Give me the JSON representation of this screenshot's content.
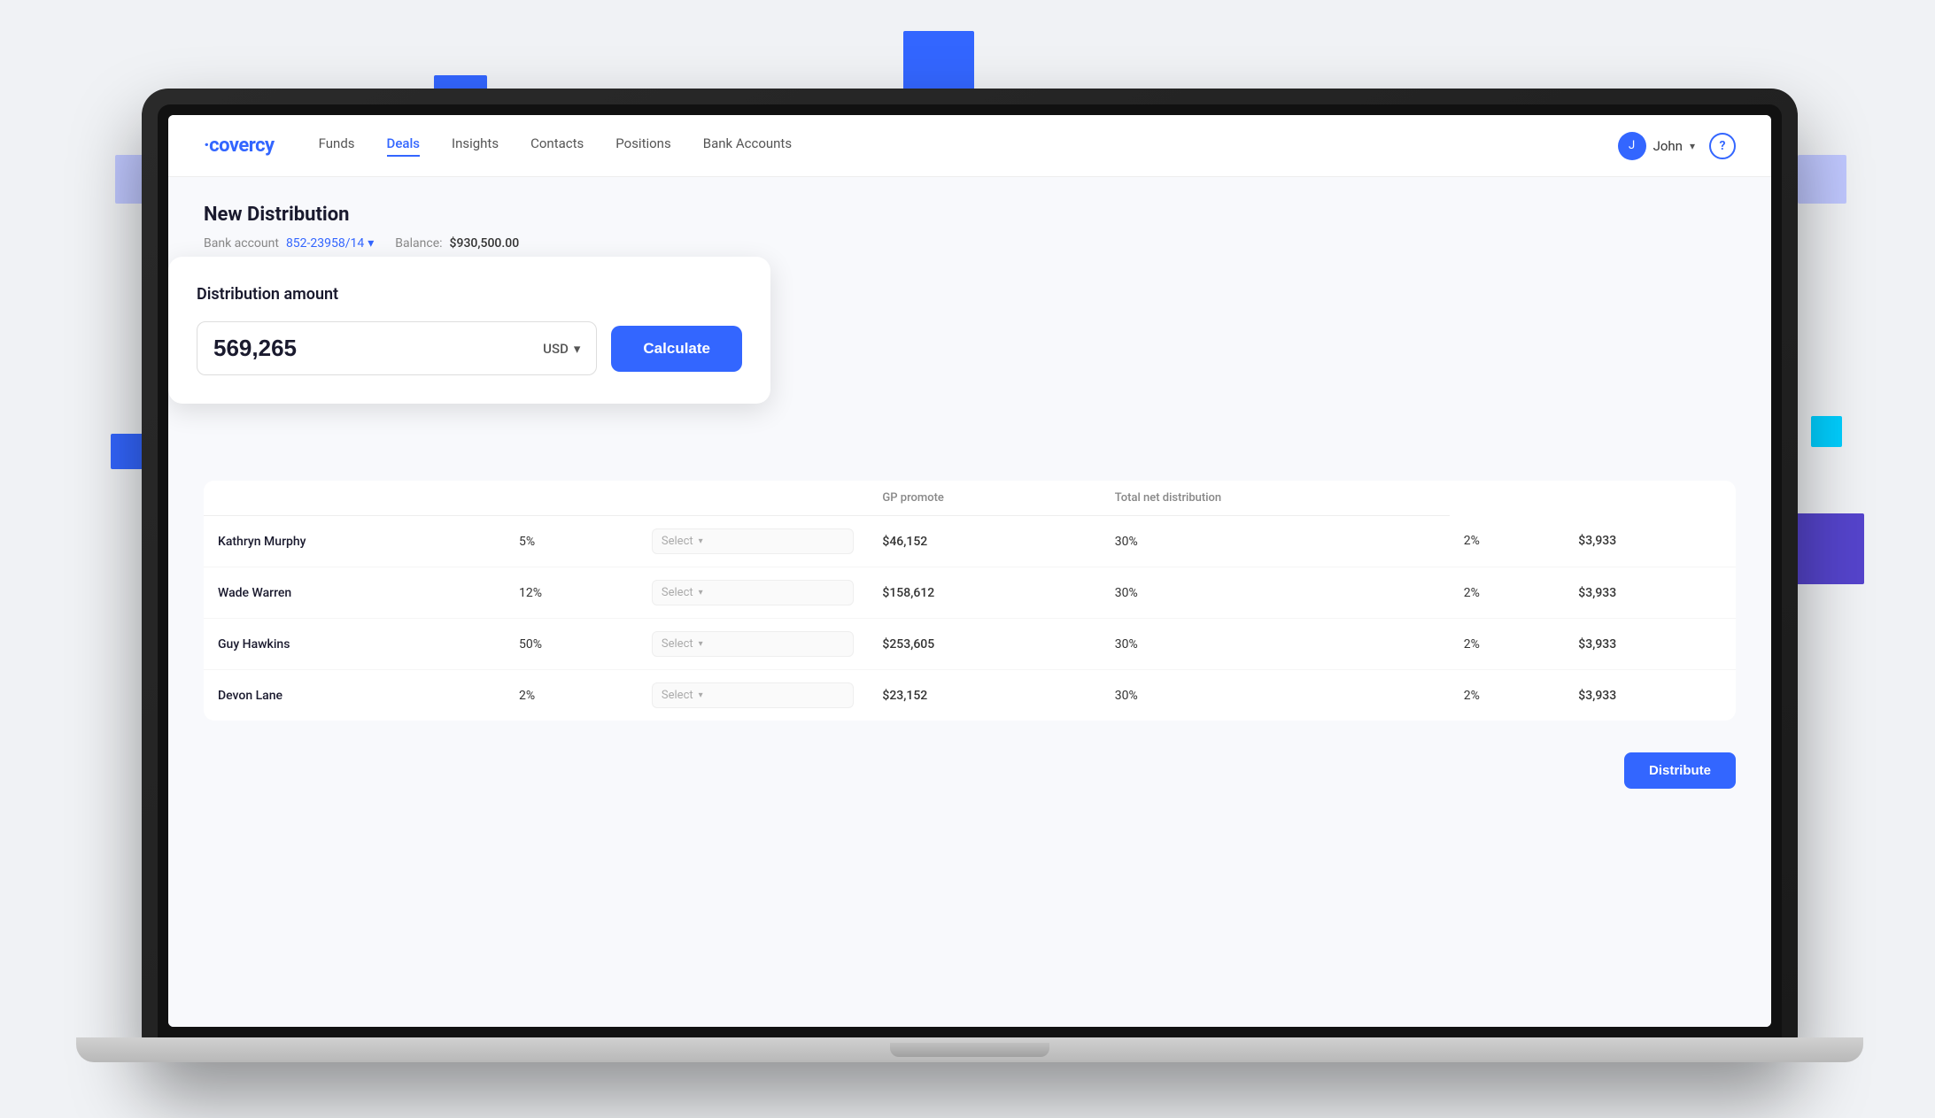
{
  "decorative": {
    "squares": []
  },
  "navbar": {
    "logo": "covercy",
    "links": [
      {
        "label": "Funds",
        "id": "funds",
        "active": false
      },
      {
        "label": "Deals",
        "id": "deals",
        "active": true
      },
      {
        "label": "Insights",
        "id": "insights",
        "active": false
      },
      {
        "label": "Contacts",
        "id": "contacts",
        "active": false
      },
      {
        "label": "Positions",
        "id": "positions",
        "active": false
      },
      {
        "label": "Bank Accounts",
        "id": "bank-accounts",
        "active": false
      }
    ],
    "user": {
      "name": "John",
      "avatar_initials": "J",
      "chevron": "▾"
    },
    "help": "?"
  },
  "page": {
    "title": "New Distribution",
    "bank_account_label": "Bank account",
    "bank_account_value": "852-23958/14",
    "balance_label": "Balance:",
    "balance_value": "$930,500.00"
  },
  "distribution_card": {
    "title": "Distribution amount",
    "amount": "569,265",
    "currency": "USD",
    "currency_chevron": "▾",
    "calculate_label": "Calculate"
  },
  "table": {
    "columns": [
      "",
      "",
      "",
      "GP promote",
      "Total net distribution"
    ],
    "rows": [
      {
        "name": "Kathryn Murphy",
        "percent": "5%",
        "select_placeholder": "Select",
        "amount": "$46,152",
        "hurdle": "30%",
        "gp_promote": "2%",
        "net_distribution": "$3,933"
      },
      {
        "name": "Wade Warren",
        "percent": "12%",
        "select_placeholder": "Select",
        "amount": "$158,612",
        "hurdle": "30%",
        "gp_promote": "2%",
        "net_distribution": "$3,933"
      },
      {
        "name": "Guy Hawkins",
        "percent": "50%",
        "select_placeholder": "Select",
        "amount": "$253,605",
        "hurdle": "30%",
        "gp_promote": "2%",
        "net_distribution": "$3,933"
      },
      {
        "name": "Devon Lane",
        "percent": "2%",
        "select_placeholder": "Select",
        "amount": "$23,152",
        "hurdle": "30%",
        "gp_promote": "2%",
        "net_distribution": "$3,933"
      }
    ],
    "distribute_label": "Distribute"
  }
}
